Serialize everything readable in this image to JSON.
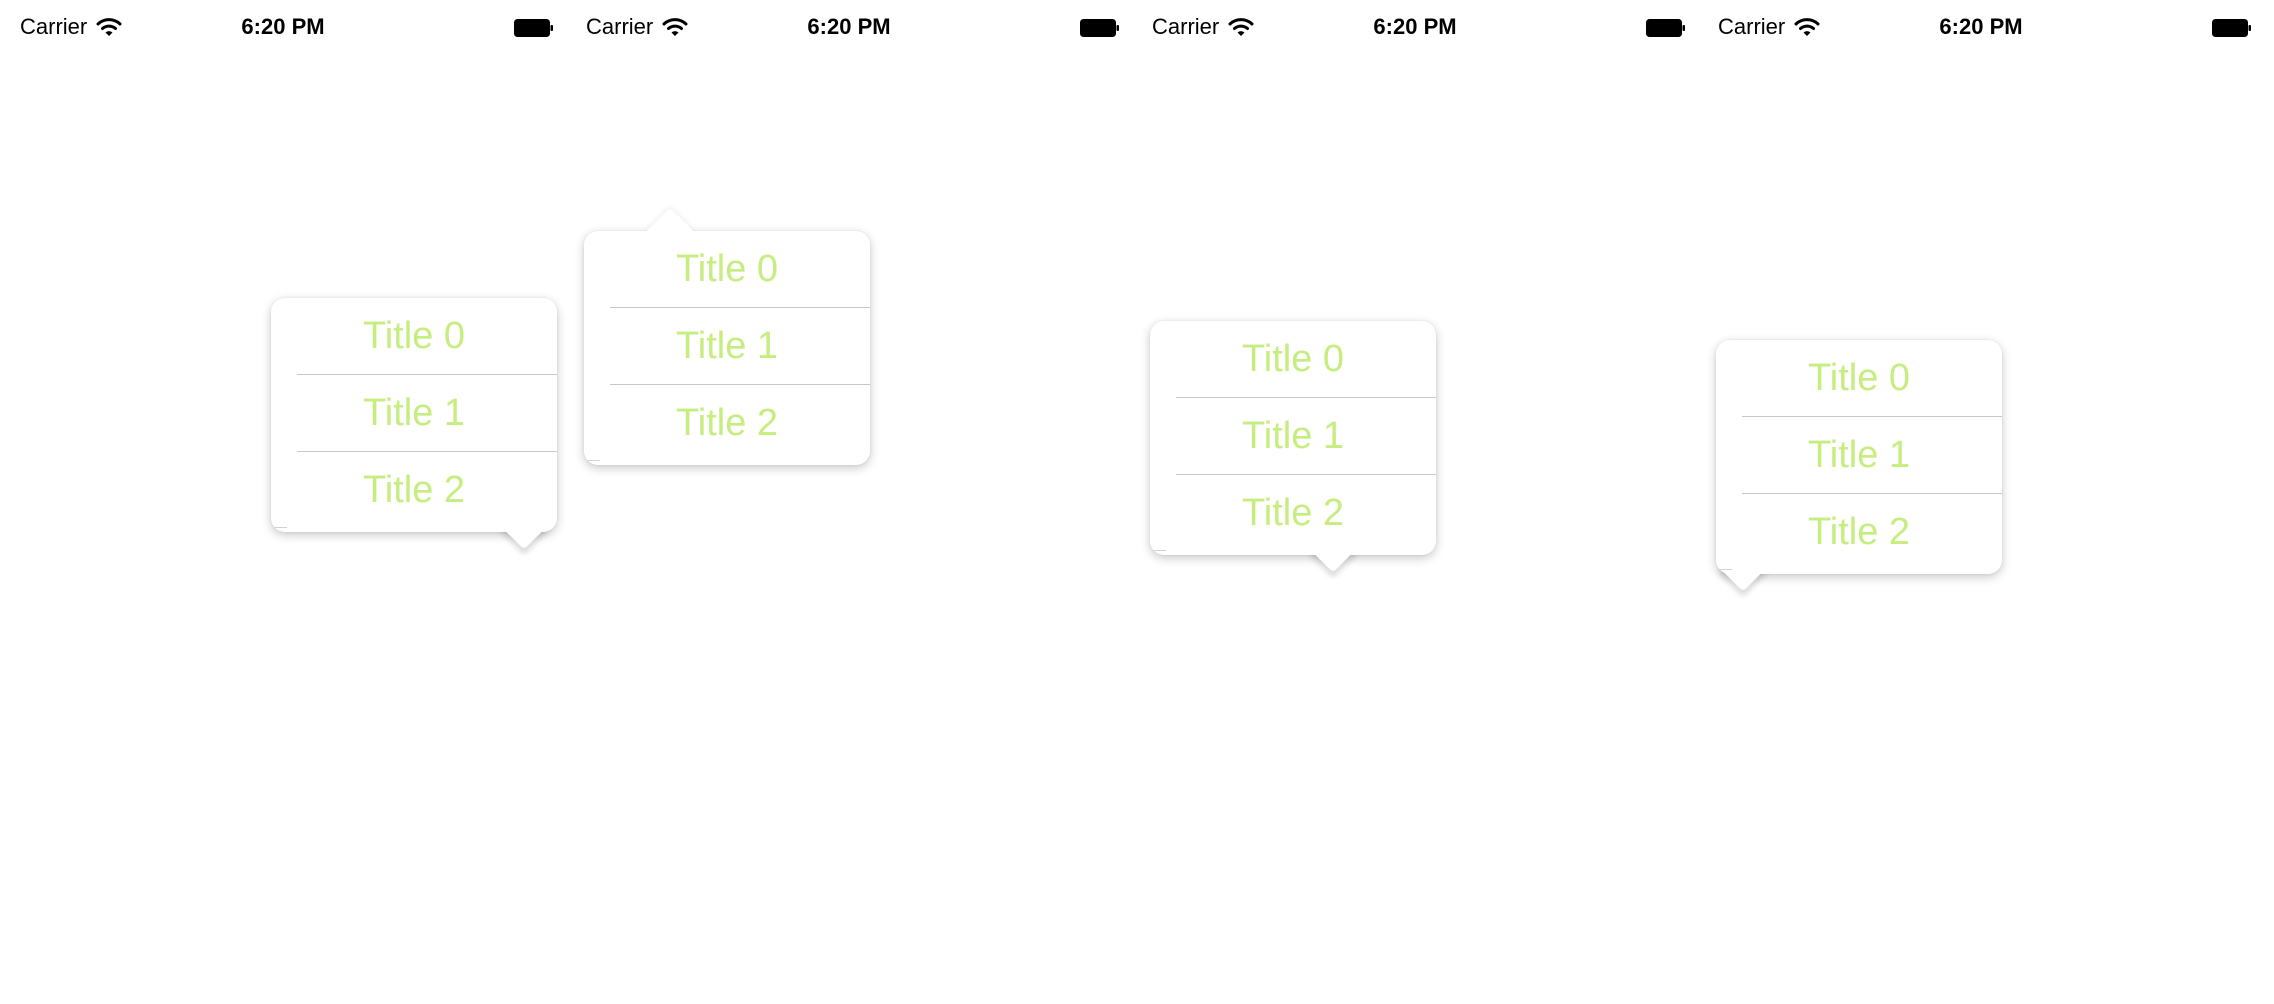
{
  "status_bar": {
    "carrier": "Carrier",
    "time": "6:20 PM",
    "wifi_icon": "wifi-icon",
    "battery_icon": "battery-icon"
  },
  "accent_color": "#c6ed7f",
  "screens": [
    {
      "arrow": "bottom-right",
      "items": [
        {
          "label": "Title 0"
        },
        {
          "label": "Title 1"
        },
        {
          "label": "Title 2"
        }
      ]
    },
    {
      "arrow": "top-left",
      "items": [
        {
          "label": "Title 0"
        },
        {
          "label": "Title 1"
        },
        {
          "label": "Title 2"
        }
      ]
    },
    {
      "arrow": "bottom-center",
      "items": [
        {
          "label": "Title 0"
        },
        {
          "label": "Title 1"
        },
        {
          "label": "Title 2"
        }
      ]
    },
    {
      "arrow": "bottom-left",
      "items": [
        {
          "label": "Title 0"
        },
        {
          "label": "Title 1"
        },
        {
          "label": "Title 2"
        }
      ]
    }
  ]
}
